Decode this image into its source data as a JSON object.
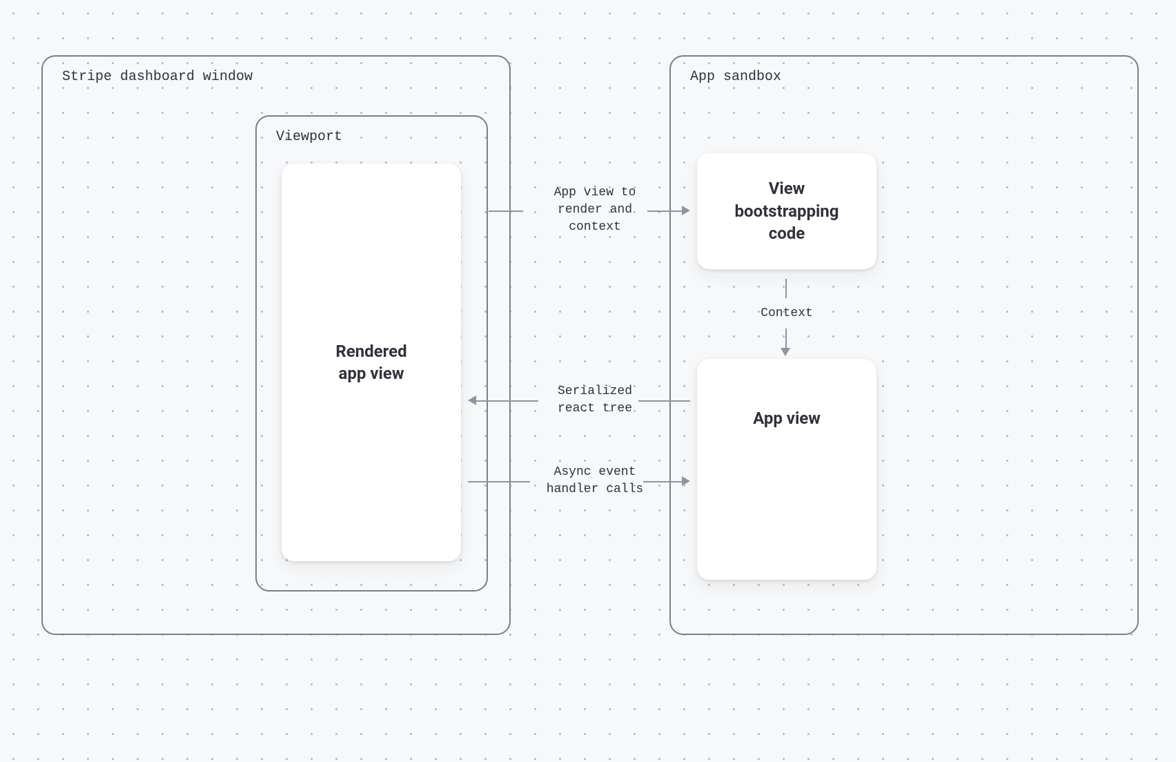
{
  "containers": {
    "dashboard": "Stripe dashboard window",
    "viewport": "Viewport",
    "sandbox": "App sandbox"
  },
  "cards": {
    "rendered": "Rendered\napp view",
    "bootstrap": "View\nbootstrapping\ncode",
    "appview": "App view"
  },
  "flows": {
    "render_ctx": "App view to\nrender and\ncontext",
    "context": "Context",
    "react_tree": "Serialized\nreact tree",
    "async_calls": "Async event\nhandler calls"
  }
}
